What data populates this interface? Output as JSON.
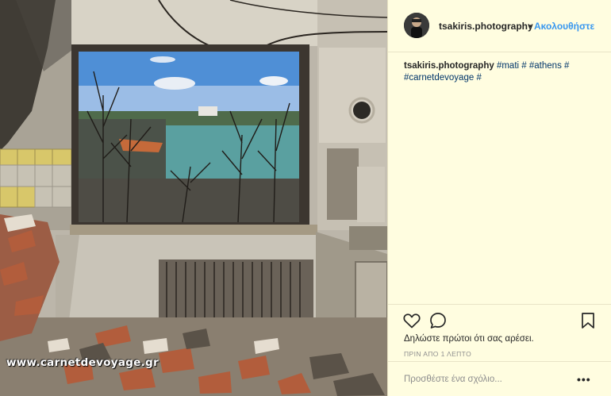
{
  "post": {
    "username": "tsakiris.photography",
    "dot": "•",
    "follow_label": "Ακολουθήστε",
    "caption": {
      "username": "tsakiris.photography",
      "tags": [
        "#mati",
        "#",
        "#athens",
        "#",
        "#carnetdevoyage",
        "#"
      ]
    },
    "likes_text": "Δηλώστε πρώτοι ότι σας αρέσει.",
    "time_text": "ΠΡΙΝ ΑΠΟ 1 ΛΕΠΤΟ",
    "comment_placeholder": "Προσθέστε ένα σχόλιο...",
    "more_label": "•••"
  },
  "photo": {
    "watermark": "www.carnetdevoyage.gr"
  },
  "icons": {
    "like": "heart-icon",
    "comment": "comment-icon",
    "save": "bookmark-icon",
    "more": "more-options-icon"
  },
  "colors": {
    "panel_bg": "#fffde0",
    "link_blue": "#3897f0",
    "tag_blue": "#003569",
    "text": "#262626",
    "muted": "#8e8e8e"
  }
}
